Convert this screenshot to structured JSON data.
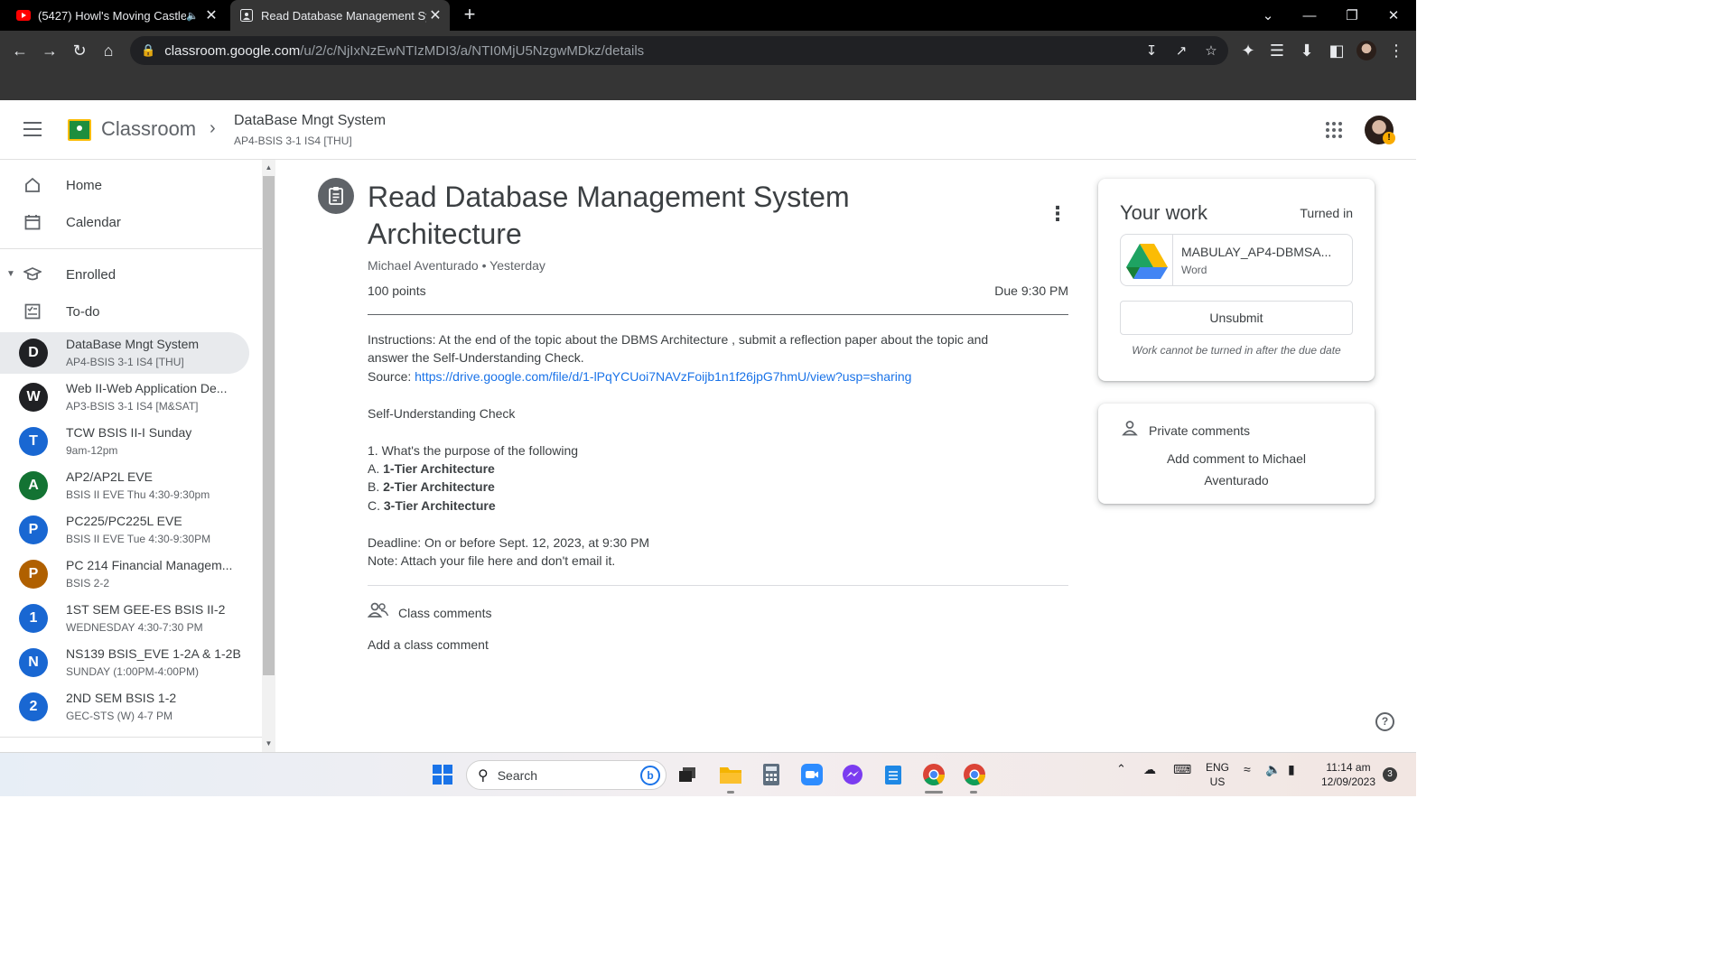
{
  "browser": {
    "tabs": [
      {
        "title": "(5427) Howl's Moving Castle",
        "active": false,
        "icon": "youtube-icon",
        "audio": true
      },
      {
        "title": "Read Database Management Sys",
        "active": true,
        "icon": "classroom-icon"
      }
    ],
    "url_host": "classroom.google.com",
    "url_path": "/u/2/c/NjIxNzEwNTIzMDI3/a/NTI0MjU5NzgwMDkz/details"
  },
  "header": {
    "app_name": "Classroom",
    "course_name": "DataBase Mngt System",
    "course_section": "AP4-BSIS 3-1 IS4 [THU]"
  },
  "sidebar": {
    "home": "Home",
    "calendar": "Calendar",
    "enrolled": "Enrolled",
    "todo": "To-do",
    "classes": [
      {
        "initial": "D",
        "name": "DataBase Mngt System",
        "sub": "AP4-BSIS 3-1 IS4 [THU]",
        "color": "#202124",
        "active": true
      },
      {
        "initial": "W",
        "name": "Web II-Web Application De...",
        "sub": "AP3-BSIS 3-1 IS4 [M&SAT]",
        "color": "#202124",
        "active": false
      },
      {
        "initial": "T",
        "name": "TCW BSIS II-I Sunday",
        "sub": "9am-12pm",
        "color": "#1967d2",
        "active": false
      },
      {
        "initial": "A",
        "name": "AP2/AP2L EVE",
        "sub": "BSIS II EVE Thu 4:30-9:30pm",
        "color": "#137333",
        "active": false
      },
      {
        "initial": "P",
        "name": "PC225/PC225L EVE",
        "sub": "BSIS II EVE Tue 4:30-9:30PM",
        "color": "#1967d2",
        "active": false
      },
      {
        "initial": "P",
        "name": "PC 214 Financial Managem...",
        "sub": "BSIS 2-2",
        "color": "#b06000",
        "active": false
      },
      {
        "initial": "1",
        "name": "1ST SEM GEE-ES BSIS II-2",
        "sub": "WEDNESDAY 4:30-7:30 PM",
        "color": "#1967d2",
        "active": false
      },
      {
        "initial": "N",
        "name": "NS139 BSIS_EVE 1-2A & 1-2B",
        "sub": "SUNDAY (1:00PM-4:00PM)",
        "color": "#1967d2",
        "active": false
      },
      {
        "initial": "2",
        "name": "2ND SEM BSIS 1-2",
        "sub": "GEC-STS (W) 4-7 PM",
        "color": "#1967d2",
        "active": false
      }
    ]
  },
  "assignment": {
    "title": "Read Database Management System Architecture",
    "author": "Michael Aventurado",
    "posted": "Yesterday",
    "points": "100 points",
    "due": "Due 9:30 PM",
    "instructions_1": "Instructions: At the end of the topic about the DBMS Architecture , submit a reflection paper about the topic and",
    "instructions_2": "answer the Self-Understanding Check.",
    "source_label": "Source: ",
    "source_link": "https://drive.google.com/file/d/1-lPqYCUoi7NAVzFoijb1n1f26jpG7hmU/view?usp=sharing",
    "check_title": "Self-Understanding Check",
    "question": "1. What's the purpose of the following",
    "options": [
      {
        "letter": "A. ",
        "text": "1-Tier Architecture"
      },
      {
        "letter": "B. ",
        "text": "2-Tier Architecture"
      },
      {
        "letter": "C. ",
        "text": "3-Tier Architecture"
      }
    ],
    "deadline": "Deadline: On or before Sept. 12, 2023, at 9:30 PM",
    "note": "Note: Attach your file here and don't email it.",
    "class_comments": "Class comments",
    "add_class_comment": "Add a class comment"
  },
  "your_work": {
    "title": "Your work",
    "status": "Turned in",
    "file_name": "MABULAY_AP4-DBMSA...",
    "file_type": "Word",
    "unsubmit": "Unsubmit",
    "late_note": "Work cannot be turned in after the due date"
  },
  "private_comments": {
    "title": "Private comments",
    "add": "Add comment to Michael Aventurado"
  },
  "help": "?",
  "taskbar": {
    "search": "Search",
    "lang_1": "ENG",
    "lang_2": "US",
    "time": "11:14 am",
    "date": "12/09/2023",
    "notifications": "3"
  }
}
